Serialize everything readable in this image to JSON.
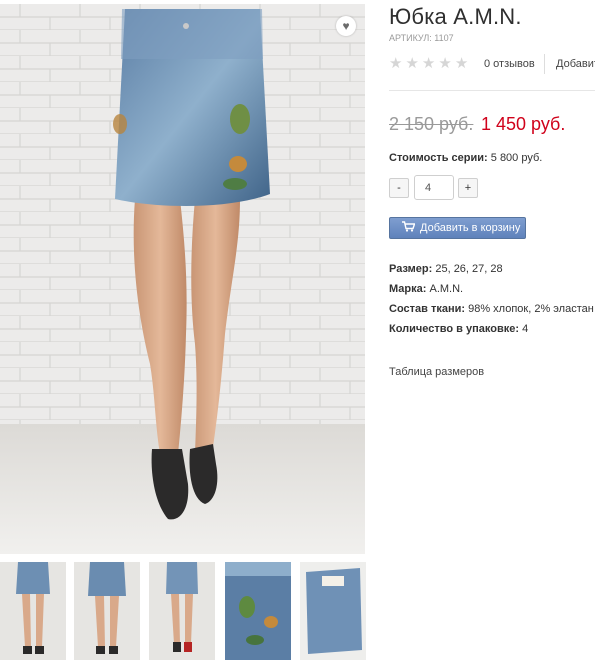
{
  "product": {
    "title": "Юбка A.M.N.",
    "sku": "АРТИКУЛ: 1107",
    "wishlist_icon": "heart-icon"
  },
  "rating": {
    "stars": 0,
    "max": 5,
    "reviews_label": "0 отзывов",
    "add_review_label": "Добавить"
  },
  "price": {
    "old": "2 150 руб.",
    "new": "1 450 руб.",
    "new_color": "#d0021b"
  },
  "series": {
    "label": "Стоимость серии:",
    "value": "5 800 руб."
  },
  "quantity": {
    "minus_label": "-",
    "value": "4",
    "plus_label": "+"
  },
  "cart": {
    "icon": "cart-icon",
    "label": "Добавить в корзину",
    "color": "#6d8fc6"
  },
  "attributes": [
    {
      "label": "Размер:",
      "value": "25, 26, 27, 28"
    },
    {
      "label": "Марка:",
      "value": "A.M.N."
    },
    {
      "label": "Состав ткани:",
      "value": "98% хлопок, 2% эластан"
    },
    {
      "label": "Количество в упаковке:",
      "value": "4"
    }
  ],
  "size_table_label": "Таблица размеров",
  "thumbnails_count": 5
}
